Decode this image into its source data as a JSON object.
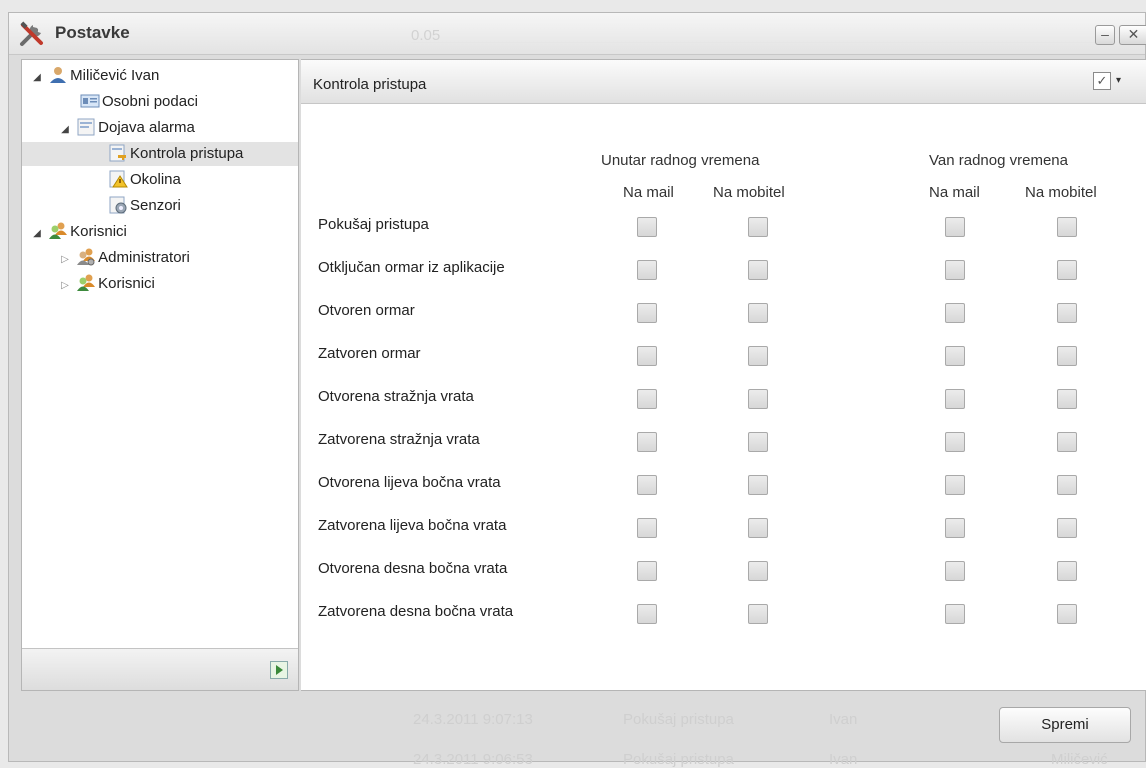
{
  "window": {
    "title": "Postavke",
    "background_field_value": "0.05",
    "minimize_glyph": "–",
    "close_glyph": "✕"
  },
  "tree": {
    "items": [
      {
        "label": "Miličević Ivan",
        "icon": "user-icon",
        "expanded": true
      },
      {
        "label": "Osobni podaci",
        "icon": "id-card-icon"
      },
      {
        "label": "Dojava alarma",
        "icon": "alarm-folder-icon",
        "expanded": true
      },
      {
        "label": "Kontrola pristupa",
        "icon": "access-control-icon",
        "selected": true
      },
      {
        "label": "Okolina",
        "icon": "environment-warning-icon"
      },
      {
        "label": "Senzori",
        "icon": "sensors-icon"
      },
      {
        "label": "Korisnici",
        "icon": "users-group-icon",
        "expanded": true
      },
      {
        "label": "Administratori",
        "icon": "admin-group-icon",
        "expanded": false
      },
      {
        "label": "Korisnici",
        "icon": "users-group-icon",
        "expanded": false
      }
    ],
    "footer_button_icon": "expand-panel-icon"
  },
  "main": {
    "title": "Kontrola pristupa",
    "groups": [
      "Unutar radnog vremena",
      "Van radnog vremena"
    ],
    "columns": [
      "Na mail",
      "Na mobitel",
      "Na mail",
      "Na mobitel"
    ],
    "rows": [
      {
        "label": "Pokušaj pristupa",
        "checks": [
          false,
          false,
          false,
          false
        ]
      },
      {
        "label": "Otključan ormar iz aplikacije",
        "checks": [
          false,
          false,
          false,
          false
        ]
      },
      {
        "label": "Otvoren ormar",
        "checks": [
          false,
          false,
          false,
          false
        ]
      },
      {
        "label": "Zatvoren ormar",
        "checks": [
          false,
          false,
          false,
          false
        ]
      },
      {
        "label": "Otvorena stražnja vrata",
        "checks": [
          false,
          false,
          false,
          false
        ]
      },
      {
        "label": "Zatvorena stražnja vrata",
        "checks": [
          false,
          false,
          false,
          false
        ]
      },
      {
        "label": "Otvorena lijeva bočna vrata",
        "checks": [
          false,
          false,
          false,
          false
        ]
      },
      {
        "label": "Zatvorena lijeva bočna vrata",
        "checks": [
          false,
          false,
          false,
          false
        ]
      },
      {
        "label": "Otvorena desna bočna vrata",
        "checks": [
          false,
          false,
          false,
          false
        ]
      },
      {
        "label": "Zatvorena desna bočna vrata",
        "checks": [
          false,
          false,
          false,
          false
        ]
      }
    ],
    "header_check_glyph": "✓",
    "header_caret_glyph": "▾"
  },
  "footer": {
    "save_label": "Spremi",
    "background_log": [
      {
        "time": "24.3.2011 9:07:13",
        "event": "Pokušaj pristupa",
        "user": "Ivan",
        "extra": ""
      },
      {
        "time": "24.3.2011 9:06:53",
        "event": "Pokušaj pristupa",
        "user": "Ivan",
        "extra": "Miličević"
      }
    ]
  },
  "colors": {
    "selected_row": "#e3e3e3",
    "panel_border": "#b5b5b5",
    "ghost_text": "#cfcfcf"
  }
}
